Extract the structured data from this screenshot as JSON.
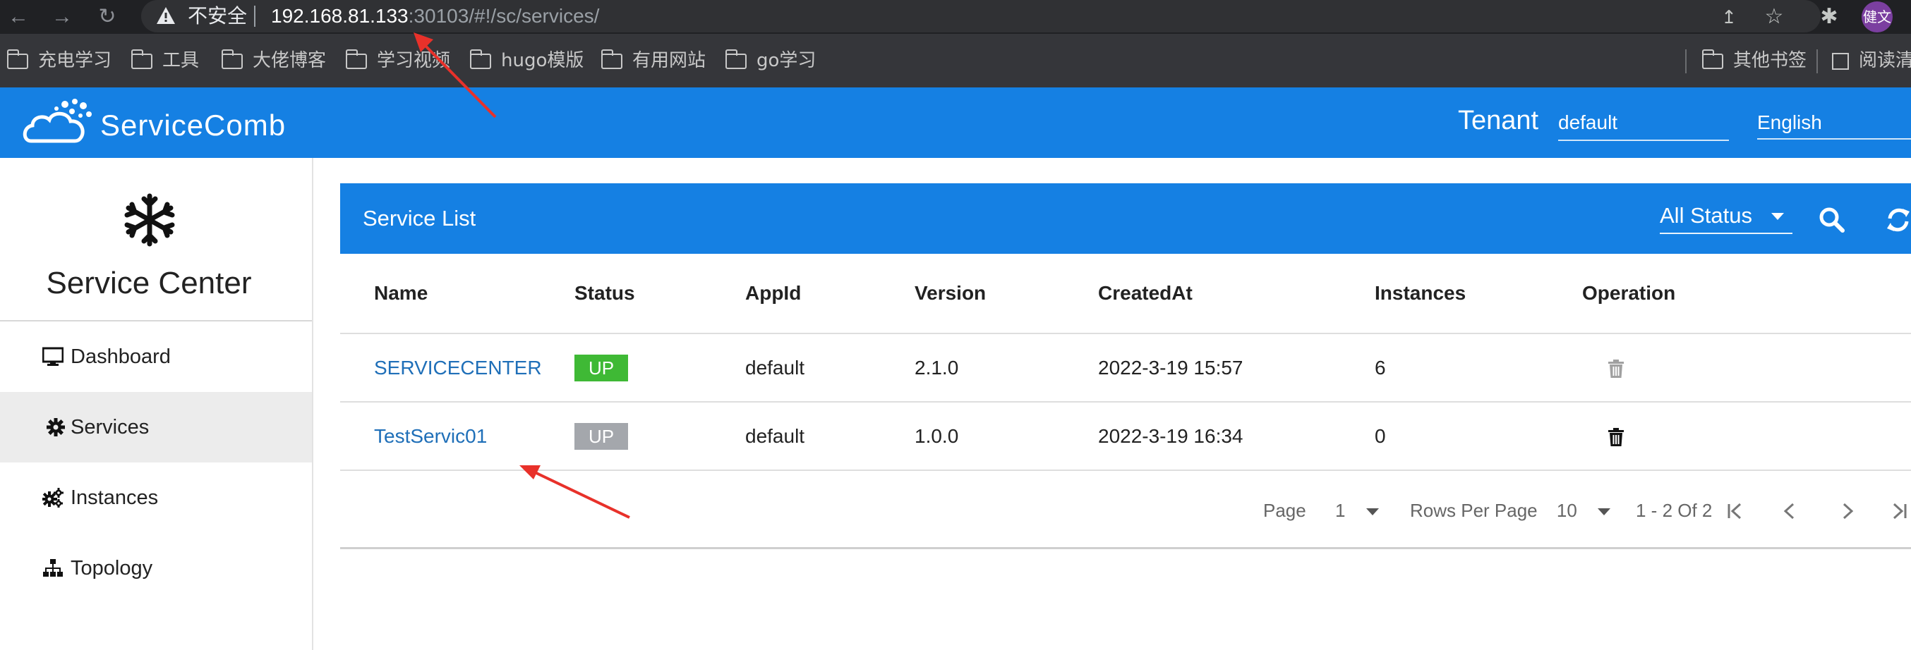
{
  "browser": {
    "security_label": "不安全",
    "url_host": "192.168.81.133",
    "url_rest": ":30103/#!/sc/services/",
    "profile_label": "健文",
    "bookmarks": [
      "充电学习",
      "工具",
      "大佬博客",
      "学习视频",
      "hugo模版",
      "有用网站",
      "go学习"
    ],
    "other_bookmarks": "其他书签",
    "reading_list": "阅读清"
  },
  "header": {
    "logo_text": "ServiceComb",
    "tenant_label": "Tenant",
    "tenant_value": "default",
    "language": "English",
    "brand_color": "#1580e3"
  },
  "sidebar": {
    "title": "Service Center",
    "items": [
      {
        "label": "Dashboard",
        "icon": "monitor-icon"
      },
      {
        "label": "Services",
        "icon": "gear-icon",
        "active": true
      },
      {
        "label": "Instances",
        "icon": "gears-icon"
      },
      {
        "label": "Topology",
        "icon": "sitemap-icon"
      }
    ]
  },
  "panel": {
    "title": "Service List",
    "status_filter": "All Status",
    "columns": [
      "Name",
      "Status",
      "AppId",
      "Version",
      "CreatedAt",
      "Instances",
      "Operation"
    ],
    "rows": [
      {
        "name": "SERVICECENTER",
        "status": "UP",
        "status_color": "#3fb935",
        "appid": "default",
        "version": "2.1.0",
        "created": "2022-3-19 15:57",
        "instances": "6"
      },
      {
        "name": "TestServic01",
        "status": "UP",
        "status_color": "#a4a7ac",
        "appid": "default",
        "version": "1.0.0",
        "created": "2022-3-19 16:34",
        "instances": "0"
      }
    ]
  },
  "pager": {
    "page_label": "Page",
    "page_value": "1",
    "rows_label": "Rows Per Page",
    "rows_value": "10",
    "range_text": "1 - 2 Of 2"
  }
}
